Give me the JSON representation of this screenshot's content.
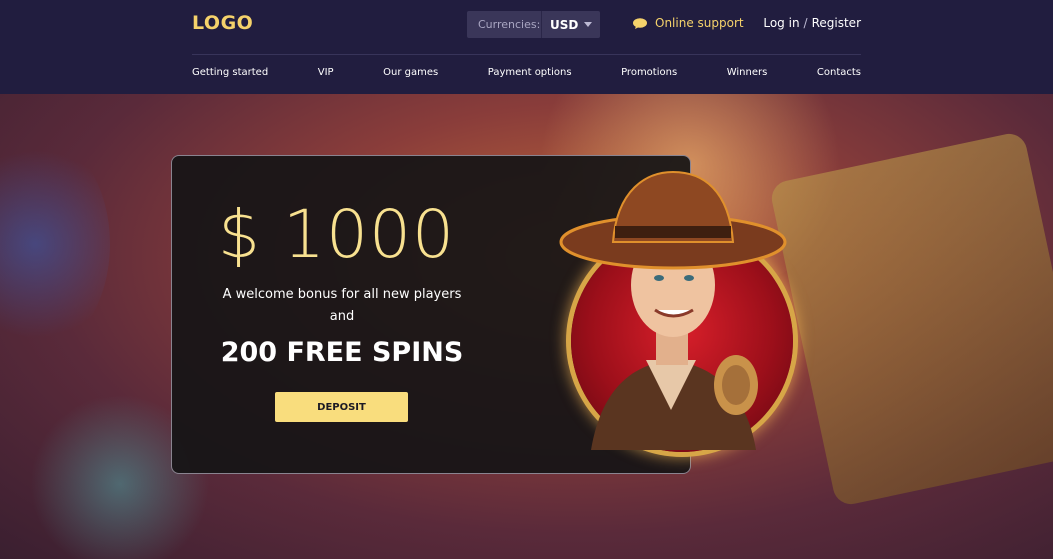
{
  "header": {
    "logo": "LOGO",
    "currency_label": "Currencies:",
    "currency_value": "USD",
    "support_label": "Online support",
    "login_label": "Log in",
    "auth_separator": "/",
    "register_label": "Register"
  },
  "nav": {
    "items": [
      {
        "label": "Getting started"
      },
      {
        "label": "VIP"
      },
      {
        "label": "Our games"
      },
      {
        "label": "Payment options"
      },
      {
        "label": "Promotions"
      },
      {
        "label": "Winners"
      },
      {
        "label": "Contacts"
      }
    ]
  },
  "promo": {
    "amount": "$ 1000",
    "welcome_text": "A welcome bonus for all new players",
    "and_text": "and",
    "spins_text": "200 FREE SPINS",
    "deposit_label": "DEPOSIT"
  },
  "colors": {
    "accent": "#f5d26b",
    "header_bg": "#211d3f",
    "button_bg": "#f9dd7d"
  }
}
